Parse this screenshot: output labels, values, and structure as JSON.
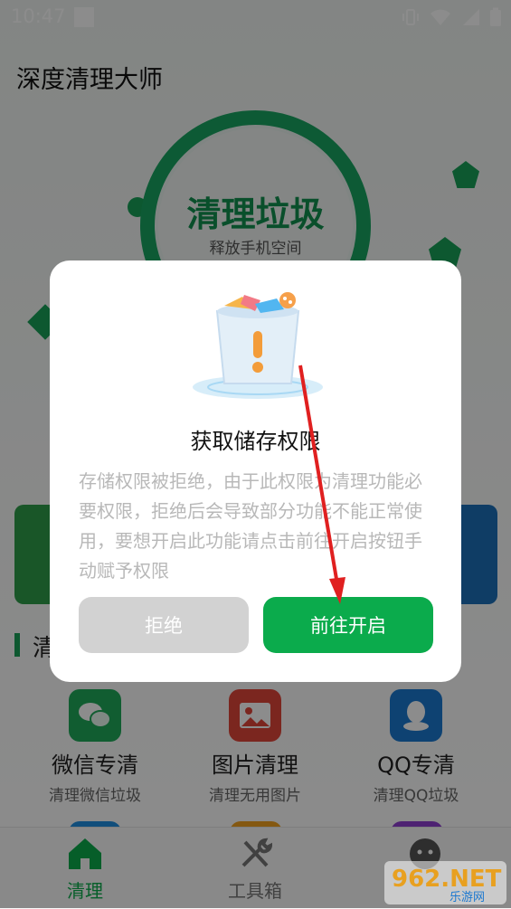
{
  "status": {
    "time": "10:47"
  },
  "app": {
    "title": "深度清理大师"
  },
  "hero": {
    "title": "清理垃圾",
    "subtitle": "释放手机空间"
  },
  "section": {
    "title": "清"
  },
  "tools": [
    {
      "label": "微信专清",
      "sub": "清理微信垃圾",
      "icon": "wechat-icon",
      "color": "#1faa5a"
    },
    {
      "label": "图片清理",
      "sub": "清理无用图片",
      "icon": "image-icon",
      "color": "#e0453a"
    },
    {
      "label": "QQ专清",
      "sub": "清理QQ垃圾",
      "icon": "qq-icon",
      "color": "#1b78d0"
    }
  ],
  "tabs": [
    {
      "label": "清理",
      "icon": "home-icon",
      "active": true
    },
    {
      "label": "工具箱",
      "icon": "tools-icon",
      "active": false
    }
  ],
  "dialog": {
    "title": "获取储存权限",
    "body": "存储权限被拒绝，由于此权限为清理功能必要权限，拒绝后会导致部分功能不能正常使用，要想开启此功能请点击前往开启按钮手动赋予权限",
    "reject_label": "拒绝",
    "go_label": "前往开启"
  },
  "watermark": {
    "brand": "962.NET",
    "tagline": "乐游网"
  },
  "colors": {
    "accent": "#0bab4c",
    "reject": "#d2d2d2",
    "arrow": "#e02020"
  }
}
